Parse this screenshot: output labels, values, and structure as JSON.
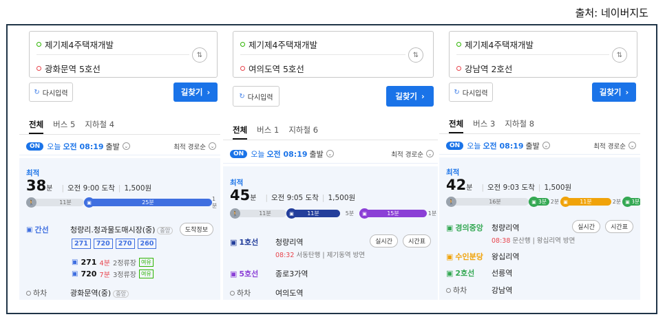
{
  "source_label": "출처: 네이버지도",
  "panels": [
    {
      "origin": "제기제4주택재개발",
      "destination": "광화문역 5호선",
      "reset_label": "다시입력",
      "search_label": "길찾기",
      "tabs": [
        "전체",
        "버스 5",
        "지하철 4"
      ],
      "on_label": "ON",
      "today": "오늘",
      "depart_time": "오전 08:19",
      "depart_suffix": "출발",
      "sort_label": "최적 경로순",
      "best_label": "최적",
      "duration": "38",
      "duration_unit": "분",
      "arrival": "오전 9:00 도착",
      "fare": "1,500원",
      "bar": [
        {
          "label": "11분"
        },
        {
          "label": "25분"
        },
        {
          "label": "1분"
        }
      ],
      "steps": {
        "board_label": "간선",
        "board_stop": "청량리.청과물도매시장(중)",
        "board_badge": "중앙",
        "board_pill": "도착정보",
        "bus_numbers": [
          "271",
          "720",
          "270",
          "260"
        ],
        "bus_rows": [
          {
            "num": "271",
            "min": "4분",
            "stops": "2정류장",
            "crowd": "여유"
          },
          {
            "num": "720",
            "min": "7분",
            "stops": "3정류장",
            "crowd": "여유"
          }
        ],
        "alight_label": "하차",
        "alight_stop": "광화문역(중)",
        "alight_badge": "중앙"
      }
    },
    {
      "origin": "제기제4주택재개발",
      "destination": "여의도역 5호선",
      "reset_label": "다시입력",
      "search_label": "길찾기",
      "tabs": [
        "전체",
        "버스 1",
        "지하철 6"
      ],
      "on_label": "ON",
      "today": "오늘",
      "depart_time": "오전 08:19",
      "depart_suffix": "출발",
      "sort_label": "최적 경로순",
      "best_label": "최적",
      "duration": "45",
      "duration_unit": "분",
      "arrival": "오전 9:05 도착",
      "fare": "1,500원",
      "bar": [
        {
          "label": "11분"
        },
        {
          "label": "11분"
        },
        {
          "label": "5분"
        },
        {
          "label": "15분"
        },
        {
          "label": "1분"
        }
      ],
      "steps": [
        {
          "label": "1호선",
          "name": "청량리역",
          "sub_time": "08:32",
          "sub_text": "서동탄행 | 제기동역 방면",
          "pills": [
            "실시간",
            "시간표"
          ]
        },
        {
          "label": "5호선",
          "name": "종로3가역"
        },
        {
          "label": "하차",
          "name": "여의도역"
        }
      ]
    },
    {
      "origin": "제기제4주택재개발",
      "destination": "강남역 2호선",
      "reset_label": "다시입력",
      "search_label": "길찾기",
      "tabs": [
        "전체",
        "버스 3",
        "지하철 8"
      ],
      "on_label": "ON",
      "today": "오늘",
      "depart_time": "오전 08:19",
      "depart_suffix": "출발",
      "sort_label": "최적 경로순",
      "best_label": "최적",
      "duration": "42",
      "duration_unit": "분",
      "arrival": "오전 9:03 도착",
      "fare": "1,500원",
      "bar": [
        {
          "label": "16분"
        },
        {
          "label": "3분"
        },
        {
          "label": "2분"
        },
        {
          "label": "11분"
        },
        {
          "label": "2분"
        },
        {
          "label": "3분"
        }
      ],
      "steps": [
        {
          "label": "경의중앙",
          "name": "청량리역",
          "sub_time": "08:38",
          "sub_text": "문산행 | 왕십리역 방면",
          "pills": [
            "실시간",
            "시간표"
          ]
        },
        {
          "label": "수인분당",
          "name": "왕십리역"
        },
        {
          "label": "2호선",
          "name": "선릉역"
        },
        {
          "label": "하차",
          "name": "강남역"
        }
      ]
    }
  ],
  "colors": {
    "accent": "#1a73e8",
    "frame": "#1f3447",
    "line1": "#233e9b",
    "line5": "#8b3fd6",
    "gyeongui": "#34a853",
    "suin": "#f0a30a",
    "line2": "#34a853",
    "bus": "#3f6fe0"
  }
}
